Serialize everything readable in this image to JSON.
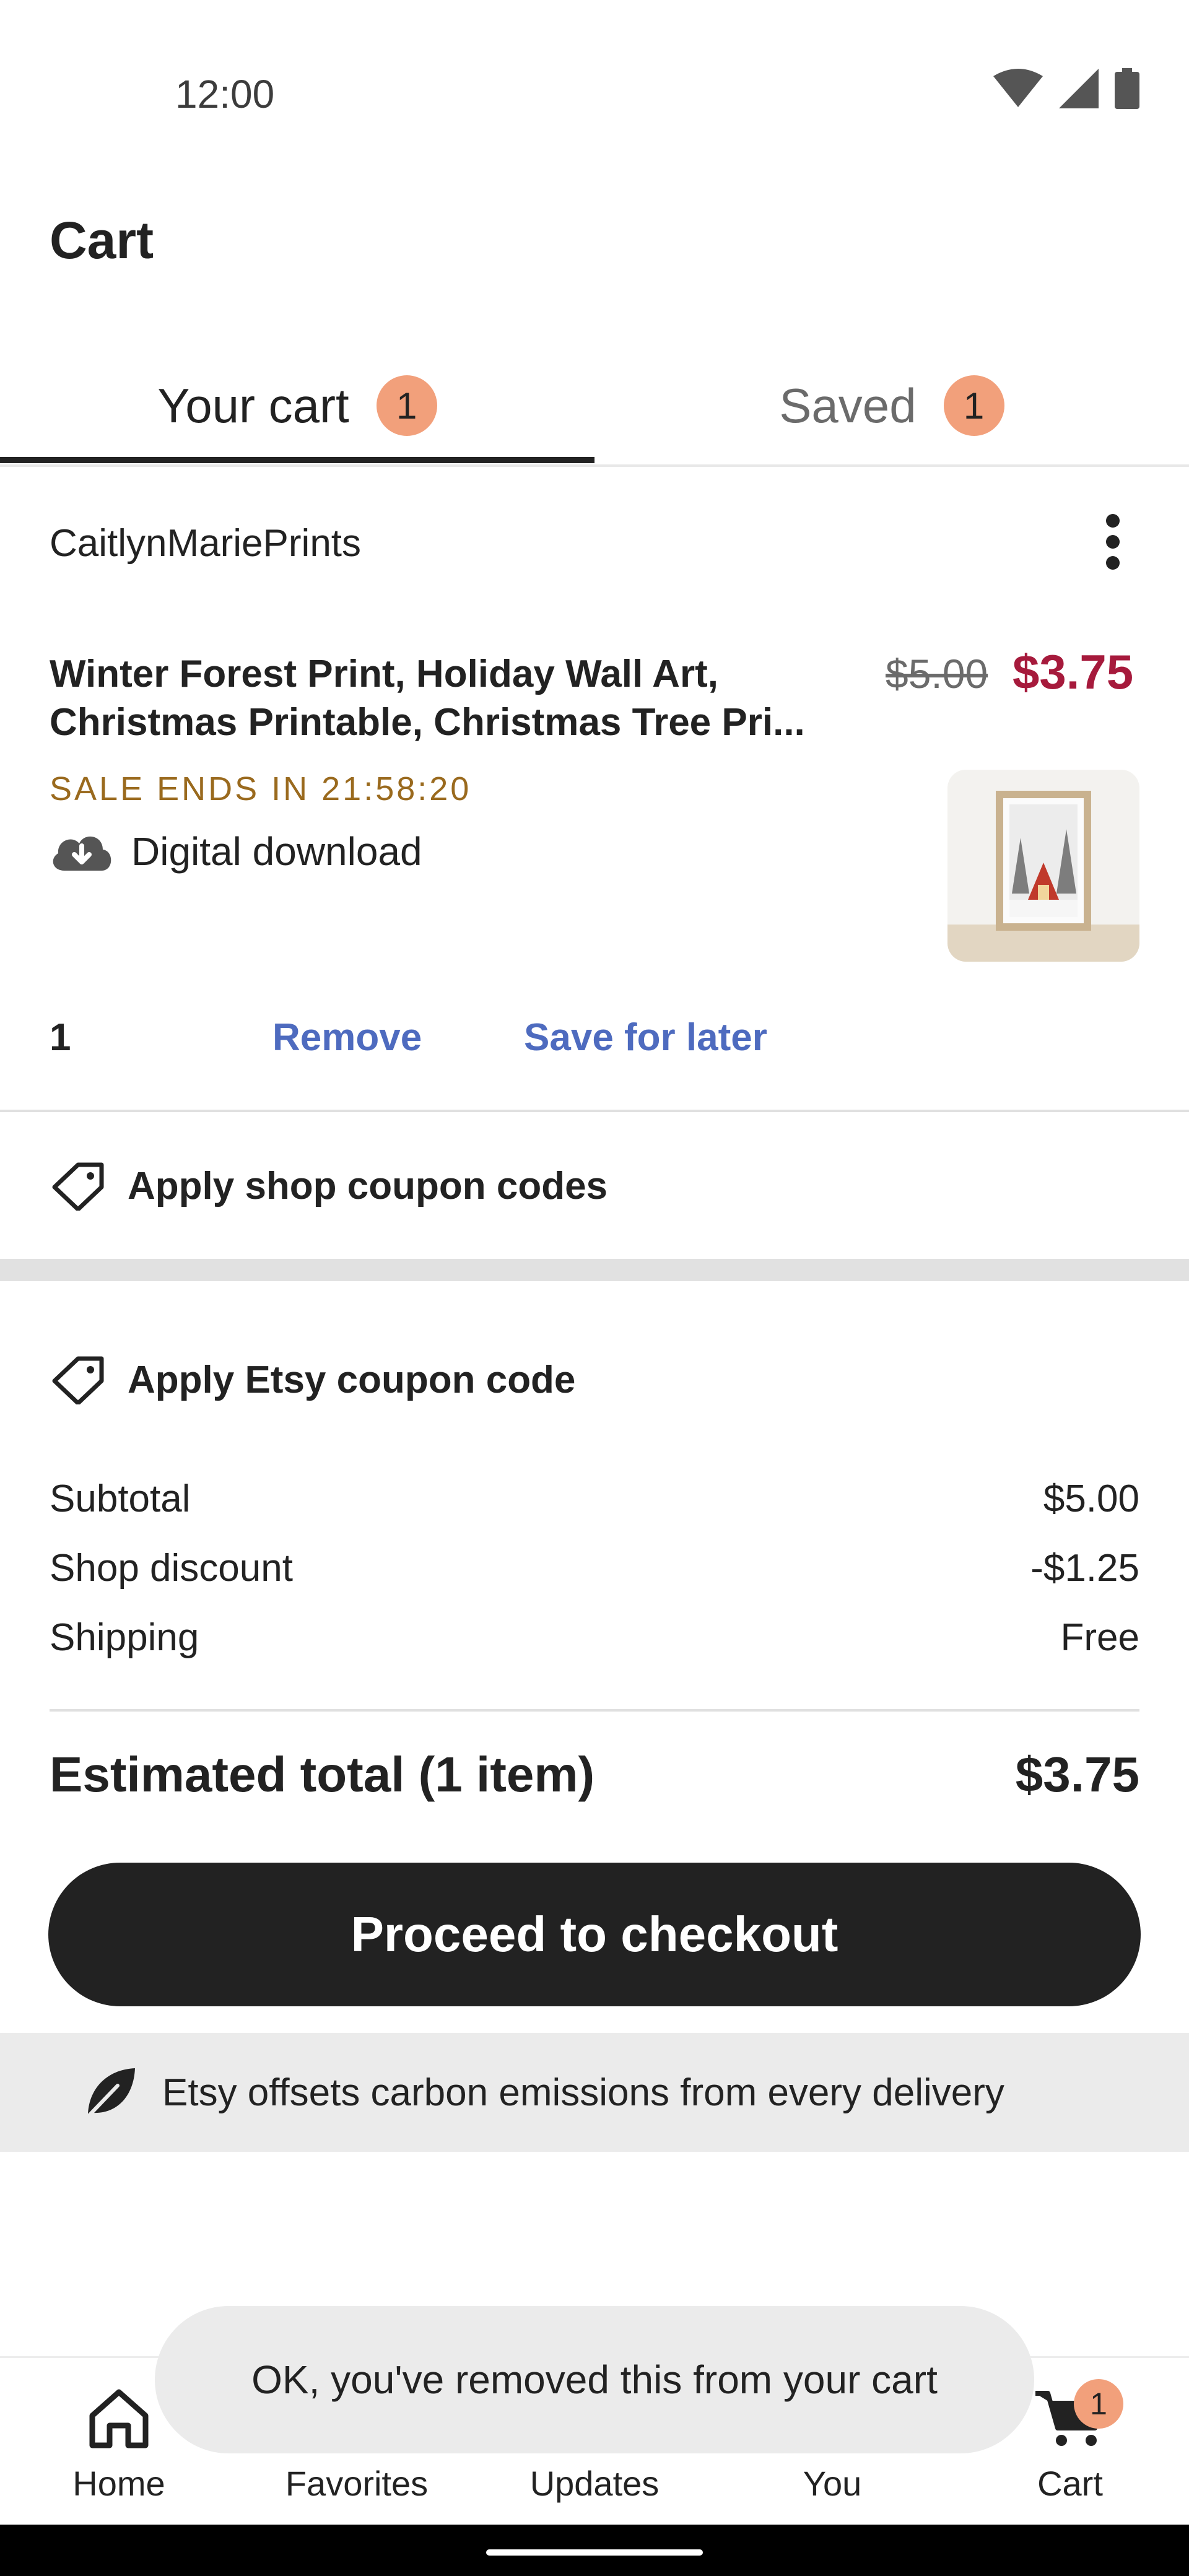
{
  "status_bar": {
    "time": "12:00"
  },
  "header": {
    "title": "Cart"
  },
  "tabs": [
    {
      "label": "Your cart",
      "count": "1",
      "active": true
    },
    {
      "label": "Saved",
      "count": "1",
      "active": false
    }
  ],
  "shop": {
    "name": "CaitlynMariePrints"
  },
  "item": {
    "title_line1": "Winter Forest Print, Holiday Wall Art,",
    "title_line2": "Christmas Printable, Christmas Tree Pri...",
    "original_price": "$5.00",
    "sale_price": "$3.75",
    "sale_ends": "SALE ENDS IN 21:58:20",
    "delivery_type": "Digital download",
    "quantity": "1",
    "remove_label": "Remove",
    "save_for_later_label": "Save for later"
  },
  "coupons": {
    "shop_coupon_label": "Apply shop coupon codes",
    "etsy_coupon_label": "Apply Etsy coupon code"
  },
  "summary": {
    "rows": [
      {
        "label": "Subtotal",
        "value": "$5.00"
      },
      {
        "label": "Shop discount",
        "value": "-$1.25"
      },
      {
        "label": "Shipping",
        "value": "Free"
      }
    ],
    "total_label": "Estimated total (1 item)",
    "total_value": "$3.75"
  },
  "checkout": {
    "label": "Proceed to checkout"
  },
  "carbon_notice": "Etsy offsets carbon emissions from every delivery",
  "toast": "OK, you've removed this from your cart",
  "bottom_nav": {
    "items": [
      {
        "label": "Home",
        "icon": "home-icon"
      },
      {
        "label": "Favorites",
        "icon": "heart-icon"
      },
      {
        "label": "Updates",
        "icon": "bell-icon"
      },
      {
        "label": "You",
        "icon": "person-icon"
      },
      {
        "label": "Cart",
        "icon": "cart-icon",
        "badge": "1"
      }
    ]
  },
  "colors": {
    "sale_price": "#a61a3c",
    "sale_ends": "#9a6a1e",
    "link": "#4e6bbf",
    "badge": "#f2a07b",
    "checkout_button": "#222222"
  }
}
